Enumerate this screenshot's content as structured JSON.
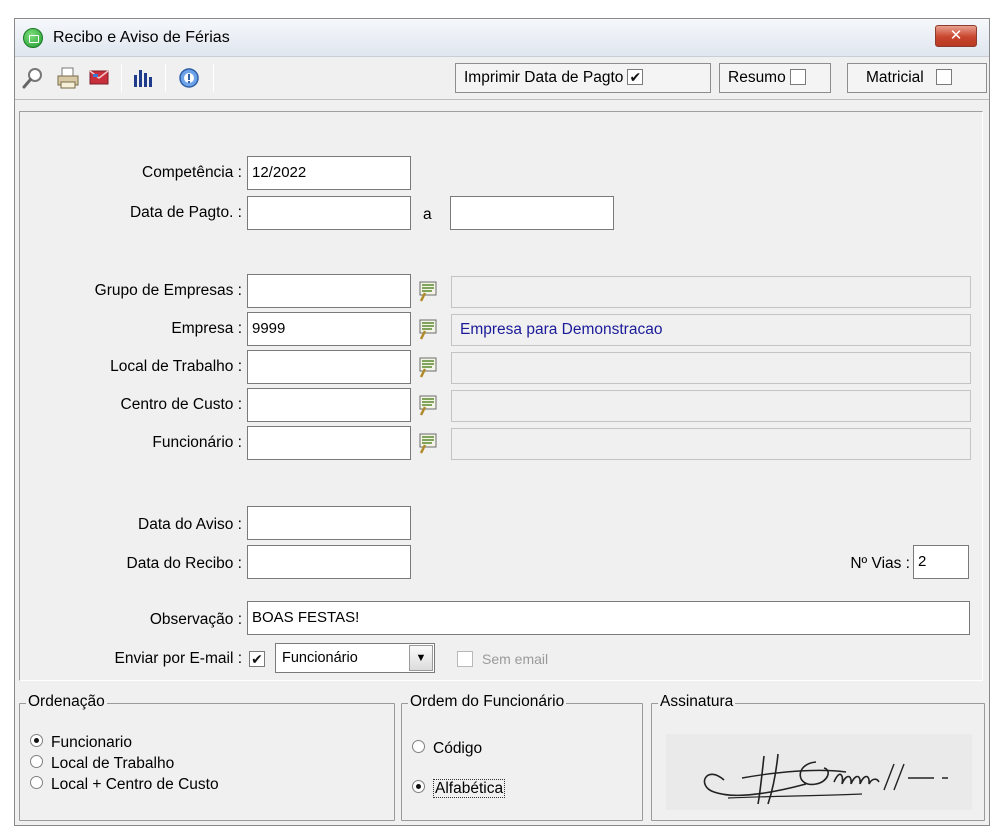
{
  "window": {
    "title": "Recibo e Aviso de Férias",
    "close_label": "✕"
  },
  "toolbar": {
    "icons": [
      "search-icon",
      "print-icon",
      "email-icon",
      "chart-icon",
      "info-icon"
    ],
    "imprimir_label": "Imprimir Data de Pagto",
    "imprimir_checked": "✔",
    "resumo_label": "Resumo",
    "matricial_label": "Matricial"
  },
  "form": {
    "competencia": {
      "label": "Competência :",
      "value": "12/2022"
    },
    "data_pagto": {
      "label": "Data de Pagto. :",
      "from": "",
      "sep": "a",
      "to": ""
    },
    "grupo_empresas": {
      "label": "Grupo de Empresas :",
      "code": "",
      "name": ""
    },
    "empresa": {
      "label": "Empresa :",
      "code": "9999",
      "name": "Empresa para Demonstracao"
    },
    "local_trabalho": {
      "label": "Local de Trabalho :",
      "code": "",
      "name": ""
    },
    "centro_custo": {
      "label": "Centro de Custo :",
      "code": "",
      "name": ""
    },
    "funcionario": {
      "label": "Funcionário :",
      "code": "",
      "name": ""
    },
    "data_aviso": {
      "label": "Data do Aviso :",
      "value": ""
    },
    "data_recibo": {
      "label": "Data do Recibo :",
      "value": ""
    },
    "vias": {
      "label": "Nº Vias :",
      "value": "2"
    },
    "observacao": {
      "label": "Observação :",
      "value": "BOAS FESTAS!"
    },
    "enviar_email": {
      "label": "Enviar por E-mail :",
      "checked": "✔",
      "select_value": "Funcionário",
      "sem_email_label": "Sem email"
    }
  },
  "ordenacao": {
    "legend": "Ordenação",
    "options": [
      "Funcionario",
      "Local de Trabalho",
      "Local + Centro de Custo"
    ],
    "selected": 0
  },
  "ordem_funcionario": {
    "legend": "Ordem do Funcionário",
    "options": [
      "Código",
      "Alfabética"
    ],
    "selected": 1
  },
  "assinatura": {
    "legend": "Assinatura"
  }
}
